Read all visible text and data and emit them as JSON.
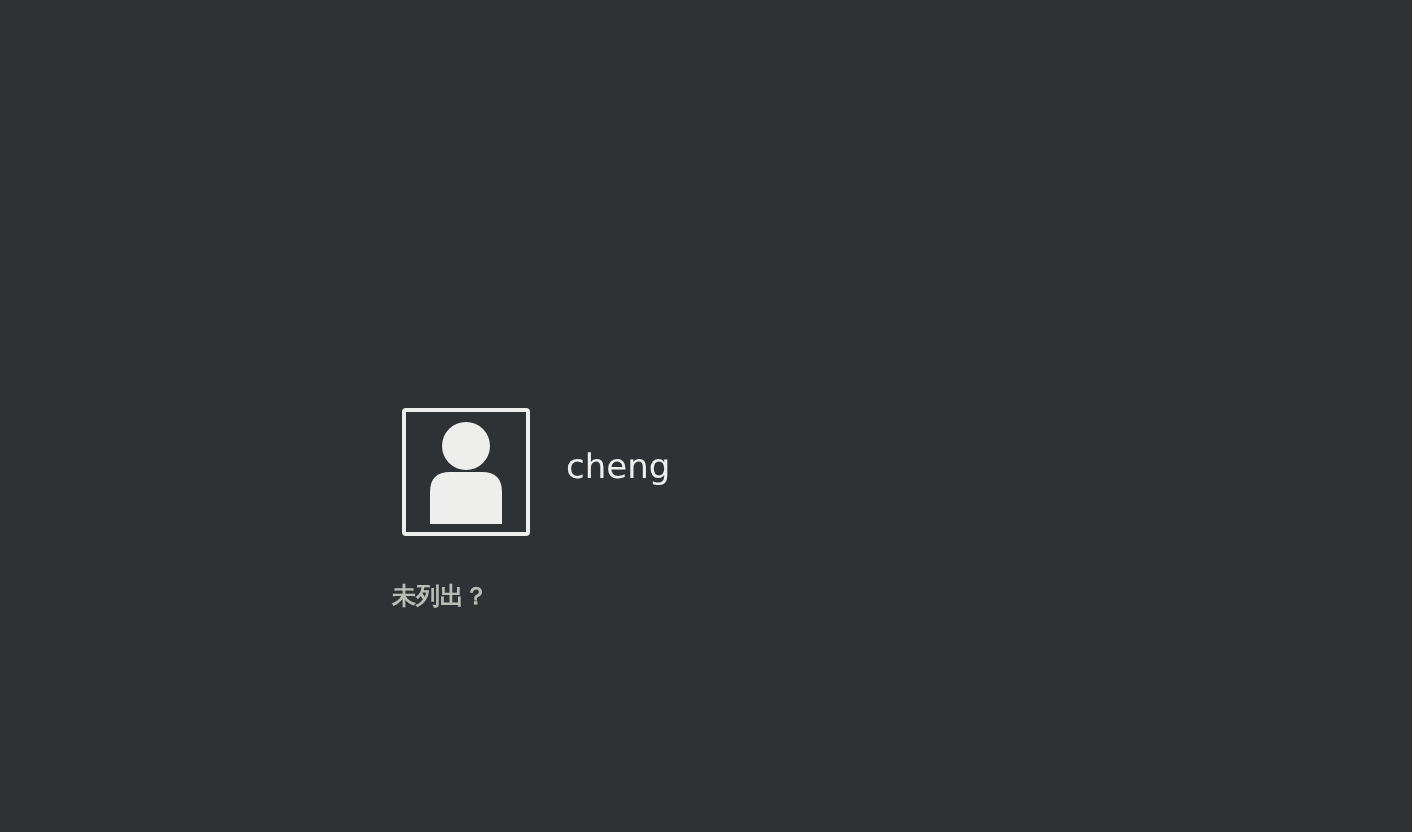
{
  "users": [
    {
      "name": "cheng"
    }
  ],
  "not_listed": {
    "label": "未列出？"
  }
}
